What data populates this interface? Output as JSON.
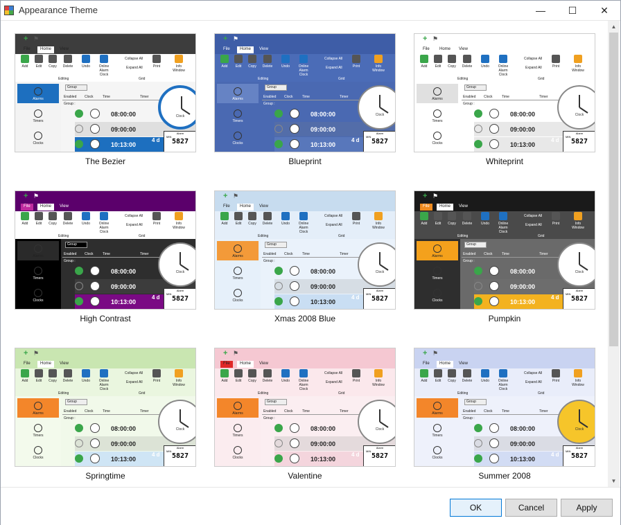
{
  "window": {
    "title": "Appearance Theme",
    "minimize": "—",
    "maximize": "☐",
    "close": "✕"
  },
  "thumb_text": {
    "tab_file": "File",
    "tab_home": "Home",
    "tab_view": "View",
    "btn_add": "Add",
    "btn_edit": "Edit",
    "btn_copy": "Copy",
    "btn_delete": "Delete",
    "btn_undo": "Undo",
    "btn_online": "Online Alarm Clock",
    "btn_collapse": "Collapse All",
    "btn_expand": "Expand All",
    "btn_print": "Print",
    "btn_info": "Info Window",
    "grp_editing": "Editing",
    "grp_grid": "Grid",
    "side_alarms": "Alarms",
    "side_timers": "Timers",
    "side_clocks": "Clocks",
    "col_group": "Group",
    "col_enabled": "Enabled",
    "col_clock": "Clock",
    "col_time": "Time",
    "col_timer": "Timer",
    "group_row": "Group :",
    "time1": "08:00:00",
    "time2": "09:00:00",
    "time3": "10:13:00",
    "clock_label": "Clock",
    "alarm_label": "Alarm",
    "min_label": "MIN",
    "digits": "5827",
    "days": "4 d"
  },
  "themes": [
    {
      "name": "The Bezier",
      "bar": "#3d3d3d",
      "ribbon": "#ffffff",
      "side": "#f3f3f3",
      "sideSel": "#1d6fbf",
      "grid": "#f5f5f5",
      "row3": "#1d6fbf",
      "accent": "#1f70c1",
      "text": "#222222"
    },
    {
      "name": "Blueprint",
      "bar": "#3e5da7",
      "ribbon": "#4b6cb7",
      "side": "#4a69b2",
      "sideSel": "#6683c4",
      "grid": "#4a69b2",
      "row3": "#5877bb",
      "accent": "#ffffff",
      "text": "#ffffff"
    },
    {
      "name": "Whiteprint",
      "bar": "#ffffff",
      "ribbon": "#ffffff",
      "side": "#ffffff",
      "sideSel": "#e0e0e0",
      "grid": "#ffffff",
      "row3": "#e8e8e8",
      "accent": "#333333",
      "text": "#222222"
    },
    {
      "name": "High Contrast",
      "bar": "#5b006b",
      "ribbon": "#ffffff",
      "side": "#000000",
      "sideSel": "#2a2a2a",
      "grid": "#2e2e2e",
      "row3": "#7a0a84",
      "accent": "#ffffff",
      "text": "#ffffff"
    },
    {
      "name": "Xmas 2008 Blue",
      "bar": "#c7dcef",
      "ribbon": "#e4eef9",
      "side": "#e6f0fa",
      "sideSel": "#f39a39",
      "grid": "#eaf2fb",
      "row3": "#c9def3",
      "accent": "#2a6bb6",
      "text": "#222222"
    },
    {
      "name": "Pumpkin",
      "bar": "#1a1a1a",
      "ribbon": "#4a4a4a",
      "side": "#2e2e2e",
      "sideSel": "#f4a11c",
      "grid": "#6a6a6a",
      "row3": "#f3b21f",
      "accent": "#f4a11c",
      "text": "#ffffff"
    },
    {
      "name": "Springtime",
      "bar": "#c9e6b1",
      "ribbon": "#eaf6df",
      "side": "#f3faec",
      "sideSel": "#f3862a",
      "grid": "#f1f9ea",
      "row3": "#cfe5f5",
      "accent": "#3e9a3e",
      "text": "#222222"
    },
    {
      "name": "Valentine",
      "bar": "#f5c8d2",
      "ribbon": "#fbe8ec",
      "side": "#fbecef",
      "sideSel": "#f3862a",
      "grid": "#fbeef1",
      "row3": "#f4d5dd",
      "accent": "#d64a6b",
      "text": "#222222"
    },
    {
      "name": "Summer 2008",
      "bar": "#c9d3f1",
      "ribbon": "#e9edfa",
      "side": "#eef1fb",
      "sideSel": "#f3862a",
      "grid": "#eef1fb",
      "row3": "#d2dcf4",
      "accent": "#f6b01c",
      "text": "#222222"
    }
  ],
  "buttons": {
    "ok": "OK",
    "cancel": "Cancel",
    "apply": "Apply"
  }
}
